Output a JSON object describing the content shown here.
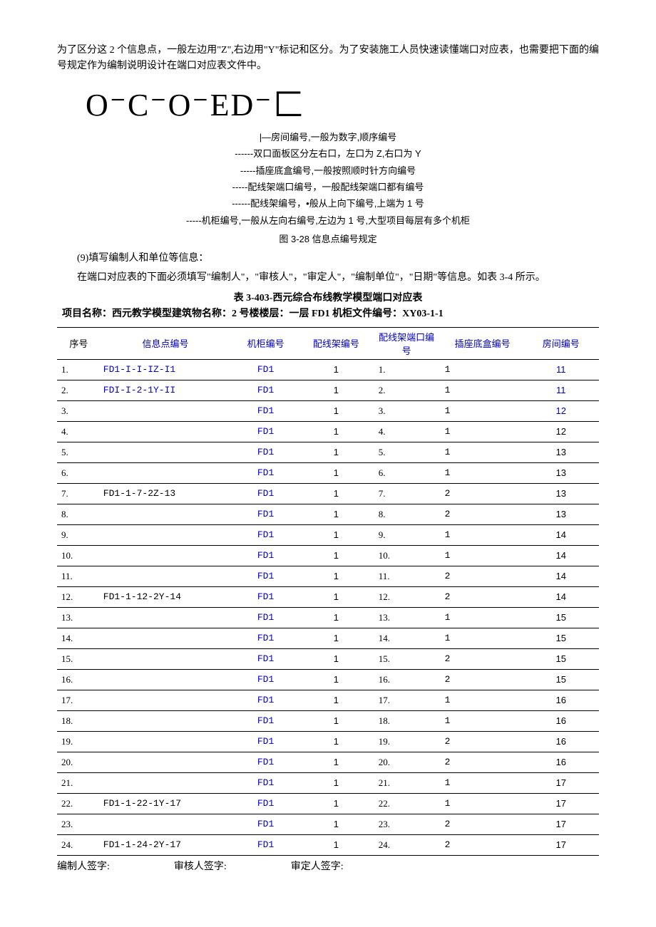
{
  "paragraphs": {
    "p1": "为了区分这 2 个信息点，一般左边用\"Z\",右边用\"Y\"标记和区分。为了安装施工人员快速读懂端口对应表，也需要把下面的编号规定作为编制说明设计在端口对应表文件中。",
    "p2": "(9)填写编制人和单位等信息：",
    "p3": "在端口对应表的下面必须填写\"编制人\"，\"审核人\"，\"审定人\"，\"编制单位\"，\"日期\"等信息。如表 3-4 所示。"
  },
  "diagram": "O⁻C⁻O⁻ED⁻匚",
  "notes": [
    "|—房间编号,一般为数字,顺序编号",
    "------双口面板区分左右口，左口为 Z,右口为 Y",
    "-----插座底盒编号,一般按照顺时针方向编号",
    "-----配线架端口编号，一般配线架端口都有编号",
    "------配线架编号，•般从上向下编号,上端为 1 号",
    "-----机柜编号,一般从左向右编号,左边为 1 号,大型项目每层有多个机柜"
  ],
  "figcap": "图 3-28 信息点编号规定",
  "tabletitle": "表 3-403-西元综合布线教学模型端口对应表",
  "projline": "项目名称：西元教学模型建筑物名称：2 号楼楼层：一层 FD1 机柜文件编号：XY03-1-1",
  "headers": {
    "seq": "序号",
    "info": "信息点编号",
    "cab": "机柜编号",
    "rack": "配线架编号",
    "port": "配线架端口编号",
    "box": "插座底盒编号",
    "room": "房间编号"
  },
  "rows": [
    {
      "seq": "1.",
      "info": "FD1-I-I-IZ-I1",
      "infoBlue": true,
      "cab": "FD1",
      "rack": "1",
      "port": "1.",
      "box": "1",
      "room": "11",
      "roomBlue": true
    },
    {
      "seq": "2.",
      "info": "FDI-I-2-1Y-II",
      "infoBlue": true,
      "cab": "FD1",
      "rack": "1",
      "port": "2.",
      "box": "1",
      "room": "11",
      "roomBlue": true
    },
    {
      "seq": "3.",
      "info": "",
      "cab": "FD1",
      "rack": "1",
      "port": "3.",
      "box": "1",
      "room": "12",
      "roomBlue": true
    },
    {
      "seq": "4.",
      "info": "",
      "cab": "FD1",
      "rack": "1",
      "port": "4.",
      "box": "1",
      "room": "12"
    },
    {
      "seq": "5.",
      "info": "",
      "cab": "FD1",
      "rack": "1",
      "port": "5.",
      "box": "1",
      "room": "13"
    },
    {
      "seq": "6.",
      "info": "",
      "cab": "FD1",
      "rack": "1",
      "port": "6.",
      "box": "1",
      "room": "13"
    },
    {
      "seq": "7.",
      "info": "FD1-1-7-2Z-13",
      "cab": "FD1",
      "rack": "1",
      "port": "7.",
      "box": "2",
      "room": "13"
    },
    {
      "seq": "8.",
      "info": "",
      "cab": "FD1",
      "rack": "1",
      "port": "8.",
      "box": "2",
      "room": "13"
    },
    {
      "seq": "9.",
      "info": "",
      "cab": "FD1",
      "rack": "1",
      "port": "9.",
      "box": "1",
      "room": "14"
    },
    {
      "seq": "10.",
      "info": "",
      "cab": "FD1",
      "rack": "1",
      "port": "10.",
      "box": "1",
      "room": "14"
    },
    {
      "seq": "11.",
      "info": "",
      "cab": "FD1",
      "rack": "1",
      "port": "11.",
      "box": "2",
      "room": "14"
    },
    {
      "seq": "12.",
      "info": "FD1-1-12-2Y-14",
      "cab": "FD1",
      "rack": "1",
      "port": "12.",
      "box": "2",
      "room": "14"
    },
    {
      "seq": "13.",
      "info": "",
      "cab": "FD1",
      "rack": "1",
      "port": "13.",
      "box": "1",
      "room": "15"
    },
    {
      "seq": "14.",
      "info": "",
      "cab": "FD1",
      "rack": "1",
      "port": "14.",
      "box": "1",
      "room": "15"
    },
    {
      "seq": "15.",
      "info": "",
      "cab": "FD1",
      "rack": "1",
      "port": "15.",
      "box": "2",
      "room": "15"
    },
    {
      "seq": "16.",
      "info": "",
      "cab": "FD1",
      "rack": "1",
      "port": "16.",
      "box": "2",
      "room": "15"
    },
    {
      "seq": "17.",
      "info": "",
      "cab": "FD1",
      "rack": "1",
      "port": "17.",
      "box": "1",
      "room": "16"
    },
    {
      "seq": "18.",
      "info": "",
      "cab": "FD1",
      "rack": "1",
      "port": "18.",
      "box": "1",
      "room": "16"
    },
    {
      "seq": "19.",
      "info": "",
      "cab": "FD1",
      "rack": "1",
      "port": "19.",
      "box": "2",
      "room": "16"
    },
    {
      "seq": "20.",
      "info": "",
      "cab": "FD1",
      "rack": "1",
      "port": "20.",
      "box": "2",
      "room": "16"
    },
    {
      "seq": "21.",
      "info": "",
      "cab": "FD1",
      "rack": "1",
      "port": "21.",
      "box": "1",
      "room": "17"
    },
    {
      "seq": "22.",
      "info": "FD1-1-22-1Y-17",
      "cab": "FD1",
      "rack": "1",
      "port": "22.",
      "box": "1",
      "room": "17"
    },
    {
      "seq": "23.",
      "info": "",
      "cab": "FD1",
      "rack": "1",
      "port": "23.",
      "box": "2",
      "room": "17"
    },
    {
      "seq": "24.",
      "info": "FD1-1-24-2Y-17",
      "cab": "FD1",
      "rack": "1",
      "port": "24.",
      "box": "2",
      "room": "17"
    }
  ],
  "sign": {
    "a": "编制人签字:",
    "b": "审核人签字:",
    "c": "审定人签字:"
  }
}
